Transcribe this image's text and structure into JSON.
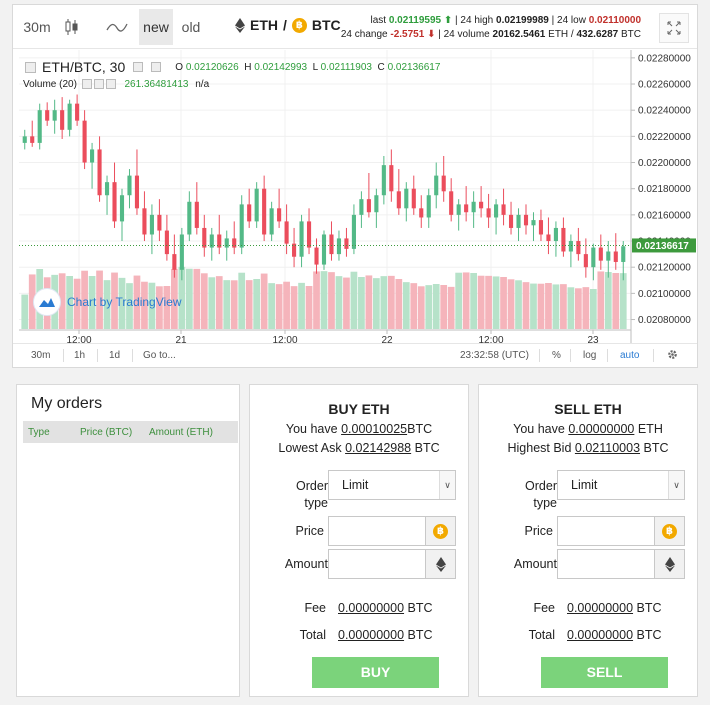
{
  "toolbar": {
    "interval": "30m",
    "style_new": "new",
    "style_old": "old",
    "pair_base": "ETH",
    "pair_sep": "/",
    "pair_quote": "BTC",
    "stats": {
      "last_label": "last",
      "last_value": "0.02119595",
      "high_label": "| 24 high",
      "high_value": "0.02199989",
      "low_label": "| 24 low",
      "low_value": "0.02110000",
      "change_label": "24 change",
      "change_value": "-2.5751",
      "volume_label": "| 24 volume",
      "volume_eth": "20162.5461",
      "volume_eth_unit": "ETH /",
      "volume_btc": "432.6287",
      "volume_btc_unit": "BTC"
    }
  },
  "chart_legend": {
    "symbol": "ETH/BTC, 30",
    "o_label": "O",
    "o_value": "0.02120626",
    "h_label": "H",
    "h_value": "0.02142993",
    "l_label": "L",
    "l_value": "0.02111903",
    "c_label": "C",
    "c_value": "0.02136617",
    "volume_label": "Volume (20)",
    "volume_value": "261.36481413",
    "volume_na": "n/a",
    "watermark": "Chart by TradingView"
  },
  "chart_data": {
    "type": "candlestick",
    "yaxis_ticks": [
      "0.02280000",
      "0.02260000",
      "0.02240000",
      "0.02220000",
      "0.02200000",
      "0.02180000",
      "0.02160000",
      "0.02140000",
      "0.02120000",
      "0.02100000",
      "0.02080000"
    ],
    "ylim": [
      0.02072,
      0.02286
    ],
    "xaxis_ticks": [
      "12:00",
      "21",
      "12:00",
      "22",
      "12:00",
      "23"
    ],
    "current_price": "0.02136617",
    "colors": {
      "up": "#53b987",
      "down": "#eb4d5c",
      "vol_up": "#b6e2c9",
      "vol_down": "#f5b4bb",
      "price_line": "#3d9a3d"
    },
    "grid": true,
    "note_values": "approximate, read from chart",
    "candles": [
      [
        0.02215,
        0.02225,
        0.0221,
        0.0222
      ],
      [
        0.0222,
        0.02232,
        0.02212,
        0.02215
      ],
      [
        0.02215,
        0.02245,
        0.0221,
        0.0224
      ],
      [
        0.0224,
        0.02246,
        0.02228,
        0.02232
      ],
      [
        0.02232,
        0.02248,
        0.02222,
        0.0224
      ],
      [
        0.0224,
        0.0225,
        0.02218,
        0.02225
      ],
      [
        0.02225,
        0.02248,
        0.0222,
        0.02245
      ],
      [
        0.02245,
        0.02252,
        0.02228,
        0.02232
      ],
      [
        0.02232,
        0.0224,
        0.02195,
        0.022
      ],
      [
        0.022,
        0.02215,
        0.0218,
        0.0221
      ],
      [
        0.0221,
        0.0222,
        0.0217,
        0.02175
      ],
      [
        0.02175,
        0.0219,
        0.0216,
        0.02185
      ],
      [
        0.02185,
        0.022,
        0.0215,
        0.02155
      ],
      [
        0.02155,
        0.0218,
        0.0214,
        0.02175
      ],
      [
        0.02175,
        0.02195,
        0.02165,
        0.0219
      ],
      [
        0.0219,
        0.0221,
        0.0216,
        0.02165
      ],
      [
        0.02165,
        0.02178,
        0.0214,
        0.02145
      ],
      [
        0.02145,
        0.02168,
        0.0213,
        0.0216
      ],
      [
        0.0216,
        0.02172,
        0.0214,
        0.02148
      ],
      [
        0.02148,
        0.0216,
        0.02125,
        0.0213
      ],
      [
        0.0213,
        0.02145,
        0.02112,
        0.02118
      ],
      [
        0.02118,
        0.0215,
        0.0211,
        0.02145
      ],
      [
        0.02145,
        0.02178,
        0.0214,
        0.0217
      ],
      [
        0.0217,
        0.02185,
        0.02145,
        0.0215
      ],
      [
        0.0215,
        0.0216,
        0.02128,
        0.02135
      ],
      [
        0.02135,
        0.0215,
        0.02125,
        0.02145
      ],
      [
        0.02145,
        0.0216,
        0.0213,
        0.02135
      ],
      [
        0.02135,
        0.02148,
        0.02125,
        0.02142
      ],
      [
        0.02142,
        0.02155,
        0.0213,
        0.02135
      ],
      [
        0.02135,
        0.02175,
        0.0213,
        0.02168
      ],
      [
        0.02168,
        0.0218,
        0.0215,
        0.02155
      ],
      [
        0.02155,
        0.02185,
        0.0215,
        0.0218
      ],
      [
        0.0218,
        0.0219,
        0.0214,
        0.02145
      ],
      [
        0.02145,
        0.0217,
        0.0214,
        0.02165
      ],
      [
        0.02165,
        0.0218,
        0.0215,
        0.02155
      ],
      [
        0.02155,
        0.02168,
        0.0213,
        0.02138
      ],
      [
        0.02138,
        0.0215,
        0.0212,
        0.02128
      ],
      [
        0.02128,
        0.0216,
        0.0212,
        0.02155
      ],
      [
        0.02155,
        0.02165,
        0.0213,
        0.02135
      ],
      [
        0.02135,
        0.02142,
        0.02115,
        0.02122
      ],
      [
        0.02122,
        0.02148,
        0.02118,
        0.02145
      ],
      [
        0.02145,
        0.02155,
        0.02125,
        0.0213
      ],
      [
        0.0213,
        0.02148,
        0.02125,
        0.02142
      ],
      [
        0.02142,
        0.0215,
        0.02128,
        0.02134
      ],
      [
        0.02134,
        0.02168,
        0.0213,
        0.0216
      ],
      [
        0.0216,
        0.02178,
        0.0215,
        0.02172
      ],
      [
        0.02172,
        0.02192,
        0.02158,
        0.02162
      ],
      [
        0.02162,
        0.0218,
        0.0215,
        0.02175
      ],
      [
        0.02175,
        0.02205,
        0.02168,
        0.02198
      ],
      [
        0.02198,
        0.0221,
        0.0217,
        0.02178
      ],
      [
        0.02178,
        0.02195,
        0.0216,
        0.02165
      ],
      [
        0.02165,
        0.02185,
        0.02155,
        0.0218
      ],
      [
        0.0218,
        0.0219,
        0.0216,
        0.02165
      ],
      [
        0.02165,
        0.02175,
        0.0215,
        0.02158
      ],
      [
        0.02158,
        0.0218,
        0.0215,
        0.02175
      ],
      [
        0.02175,
        0.022,
        0.02165,
        0.0219
      ],
      [
        0.0219,
        0.02205,
        0.0217,
        0.02178
      ],
      [
        0.02178,
        0.02188,
        0.02155,
        0.0216
      ],
      [
        0.0216,
        0.02172,
        0.02148,
        0.02168
      ],
      [
        0.02168,
        0.02182,
        0.02155,
        0.02162
      ],
      [
        0.02162,
        0.02178,
        0.0215,
        0.0217
      ],
      [
        0.0217,
        0.02182,
        0.02158,
        0.02165
      ],
      [
        0.02165,
        0.02176,
        0.0215,
        0.02158
      ],
      [
        0.02158,
        0.02172,
        0.02145,
        0.02168
      ],
      [
        0.02168,
        0.0218,
        0.02152,
        0.0216
      ],
      [
        0.0216,
        0.0217,
        0.02145,
        0.0215
      ],
      [
        0.0215,
        0.02165,
        0.0214,
        0.0216
      ],
      [
        0.0216,
        0.02168,
        0.02145,
        0.02152
      ],
      [
        0.02152,
        0.02162,
        0.0214,
        0.02156
      ],
      [
        0.02156,
        0.02164,
        0.0214,
        0.02145
      ],
      [
        0.02145,
        0.02158,
        0.0213,
        0.0214
      ],
      [
        0.0214,
        0.02155,
        0.02128,
        0.0215
      ],
      [
        0.0215,
        0.02158,
        0.02128,
        0.02132
      ],
      [
        0.02132,
        0.02145,
        0.0212,
        0.0214
      ],
      [
        0.0214,
        0.0215,
        0.02125,
        0.0213
      ],
      [
        0.0213,
        0.02142,
        0.02112,
        0.0212
      ],
      [
        0.0212,
        0.02138,
        0.0211,
        0.02135
      ],
      [
        0.02135,
        0.02145,
        0.02118,
        0.02125
      ],
      [
        0.02125,
        0.0214,
        0.02112,
        0.02132
      ],
      [
        0.02132,
        0.02146,
        0.02118,
        0.02124
      ],
      [
        0.02124,
        0.0214,
        0.0211,
        0.02136
      ]
    ]
  },
  "chart_bottom": {
    "intervals": [
      "30m",
      "1h",
      "1d"
    ],
    "goto": "Go to...",
    "time": "23:32:58 (UTC)",
    "percent": "%",
    "log": "log",
    "auto": "auto"
  },
  "orders": {
    "title": "My orders",
    "columns": [
      "Type",
      "Price (BTC)",
      "Amount (ETH)"
    ]
  },
  "buy": {
    "title": "BUY ETH",
    "have_label": "You have",
    "have_value": "0.00010025",
    "have_unit": "BTC",
    "ref_label": "Lowest Ask",
    "ref_value": "0.02142988",
    "ref_unit": "BTC",
    "order_type_label_1": "Order",
    "order_type_label_2": "type",
    "order_type_value": "Limit",
    "price_label": "Price",
    "amount_label": "Amount",
    "fee_label": "Fee",
    "fee_value": "0.00000000",
    "fee_unit": "BTC",
    "total_label": "Total",
    "total_value": "0.00000000",
    "total_unit": "BTC",
    "button": "BUY"
  },
  "sell": {
    "title": "SELL ETH",
    "have_label": "You have",
    "have_value": "0.00000000",
    "have_unit": "ETH",
    "ref_label": "Highest Bid",
    "ref_value": "0.02110003",
    "ref_unit": "BTC",
    "order_type_label_1": "Order",
    "order_type_label_2": "type",
    "order_type_value": "Limit",
    "price_label": "Price",
    "amount_label": "Amount",
    "fee_label": "Fee",
    "fee_value": "0.00000000",
    "fee_unit": "BTC",
    "total_label": "Total",
    "total_value": "0.00000000",
    "total_unit": "BTC",
    "button": "SELL"
  },
  "icons": {
    "candles": "candlestick-icon",
    "line": "line-chart-icon",
    "eth": "ethereum-icon",
    "btc": "bitcoin-icon",
    "fullscreen": "fullscreen-icon",
    "settings": "gear-icon"
  }
}
